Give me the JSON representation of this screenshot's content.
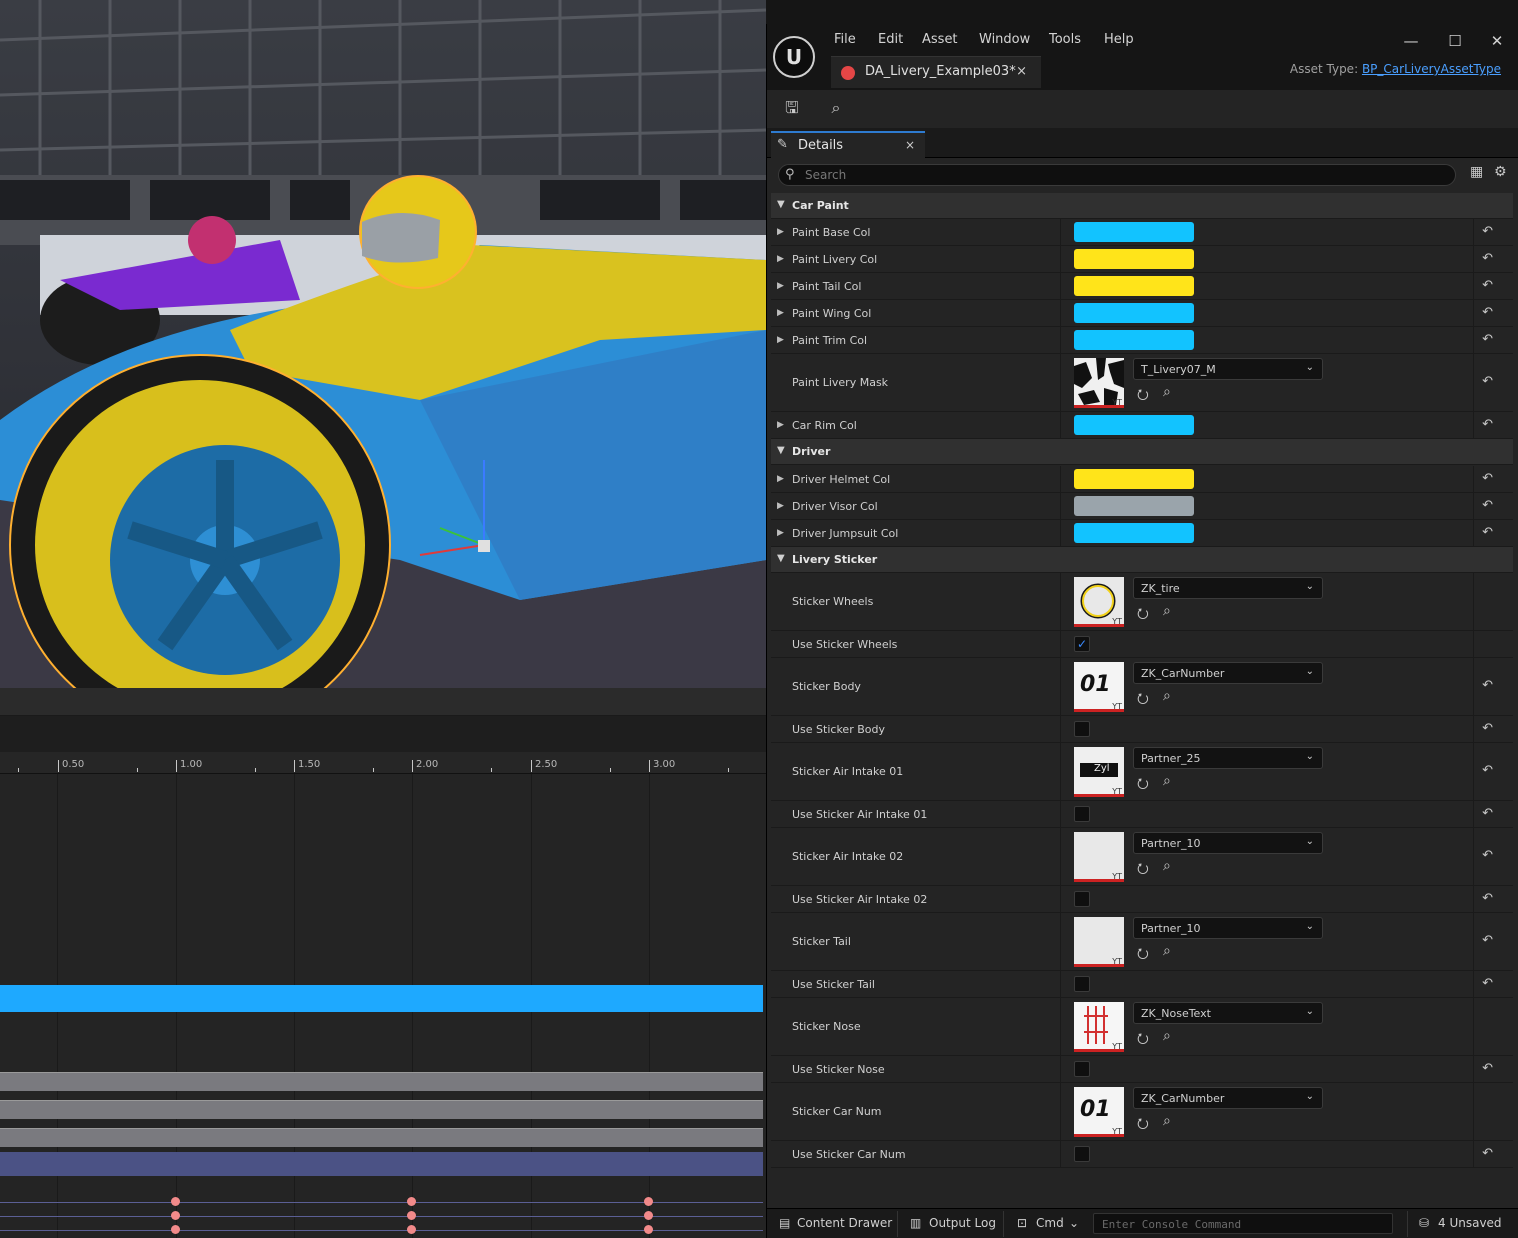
{
  "menu": {
    "items": [
      "File",
      "Edit",
      "Asset",
      "Window",
      "Tools",
      "Help"
    ]
  },
  "document_tab": {
    "label": "DA_Livery_Example03*",
    "close": "×"
  },
  "asset_type": {
    "label": "Asset Type:",
    "value": "BP_CarLiveryAssetType"
  },
  "details_tab": {
    "label": "Details",
    "close": "×"
  },
  "search": {
    "placeholder": "Search"
  },
  "categories": {
    "car_paint": "Car Paint",
    "driver": "Driver",
    "livery_sticker": "Livery Sticker"
  },
  "properties": {
    "paint_base_col": {
      "label": "Paint Base Col",
      "color": "#12c3ff"
    },
    "paint_livery_col": {
      "label": "Paint Livery Col",
      "color": "#ffe41a"
    },
    "paint_tail_col": {
      "label": "Paint Tail Col",
      "color": "#ffe41a"
    },
    "paint_wing_col": {
      "label": "Paint Wing Col",
      "color": "#12c3ff"
    },
    "paint_trim_col": {
      "label": "Paint Trim Col",
      "color": "#12c3ff"
    },
    "paint_livery_mask": {
      "label": "Paint Livery Mask",
      "asset": "T_Livery07_M"
    },
    "car_rim_col": {
      "label": "Car Rim Col",
      "color": "#12c3ff"
    },
    "driver_helmet_col": {
      "label": "Driver Helmet Col",
      "color": "#ffe41a"
    },
    "driver_visor_col": {
      "label": "Driver Visor Col",
      "color": "#9aa4ab"
    },
    "driver_jumpsuit_col": {
      "label": "Driver Jumpsuit Col",
      "color": "#12c3ff"
    },
    "sticker_wheels": {
      "label": "Sticker Wheels",
      "asset": "ZK_tire"
    },
    "use_sticker_wheels": {
      "label": "Use Sticker Wheels",
      "checked": true
    },
    "sticker_body": {
      "label": "Sticker Body",
      "asset": "ZK_CarNumber"
    },
    "use_sticker_body": {
      "label": "Use Sticker Body",
      "checked": false
    },
    "sticker_air_intake_01": {
      "label": "Sticker Air Intake 01",
      "asset": "Partner_25"
    },
    "use_sticker_air_intake_01": {
      "label": "Use Sticker Air Intake 01",
      "checked": false
    },
    "sticker_air_intake_02": {
      "label": "Sticker Air Intake 02",
      "asset": "Partner_10"
    },
    "use_sticker_air_intake_02": {
      "label": "Use Sticker Air Intake 02",
      "checked": false
    },
    "sticker_tail": {
      "label": "Sticker Tail",
      "asset": "Partner_10"
    },
    "use_sticker_tail": {
      "label": "Use Sticker Tail",
      "checked": false
    },
    "sticker_nose": {
      "label": "Sticker Nose",
      "asset": "ZK_NoseText"
    },
    "use_sticker_nose": {
      "label": "Use Sticker Nose",
      "checked": false
    },
    "sticker_car_num": {
      "label": "Sticker Car Num",
      "asset": "ZK_CarNumber"
    },
    "use_sticker_car_num": {
      "label": "Use Sticker Car Num",
      "checked": false
    }
  },
  "thumbnails": {
    "car_number_text": "01",
    "partner_25_text": "Zyl",
    "corner_mark": "YT"
  },
  "sequencer": {
    "ticks": [
      "0.50",
      "1.00",
      "1.50",
      "2.00",
      "2.50",
      "3.00"
    ],
    "track_color": "#1ea9ff"
  },
  "status_bar": {
    "content_drawer": "Content Drawer",
    "output_log": "Output Log",
    "cmd": "Cmd",
    "console_placeholder": "Enter Console Command",
    "unsaved": "4 Unsaved"
  }
}
